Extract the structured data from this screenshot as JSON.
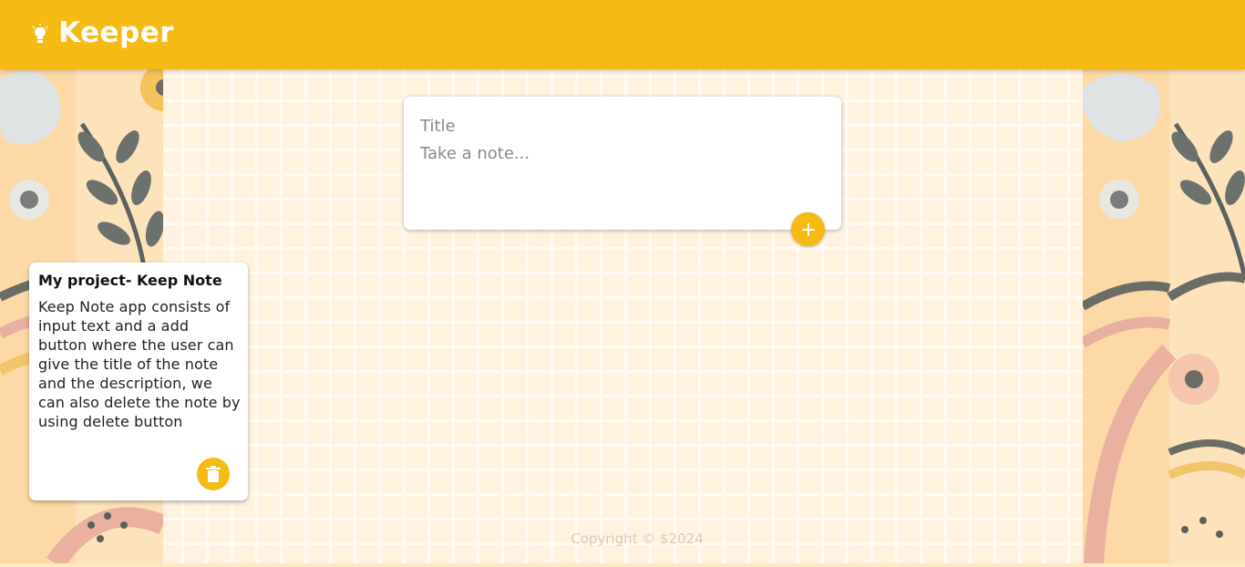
{
  "app": {
    "title": "Keeper"
  },
  "create_note": {
    "title_placeholder": "Title",
    "content_placeholder": "Take a note...",
    "title_value": "",
    "content_value": ""
  },
  "notes": [
    {
      "title": "My project- Keep Note",
      "content": "Keep Note app consists of input text and a add button where the user can give the title of the note and the description, we can also delete the note by using delete button"
    }
  ],
  "footer": {
    "text": "Copyright © $2024"
  },
  "colors": {
    "accent": "#f5ba13",
    "background": "#fde9c2"
  },
  "icons": {
    "logo": "lightbulb-icon",
    "add": "add-icon",
    "delete": "trash-icon"
  }
}
